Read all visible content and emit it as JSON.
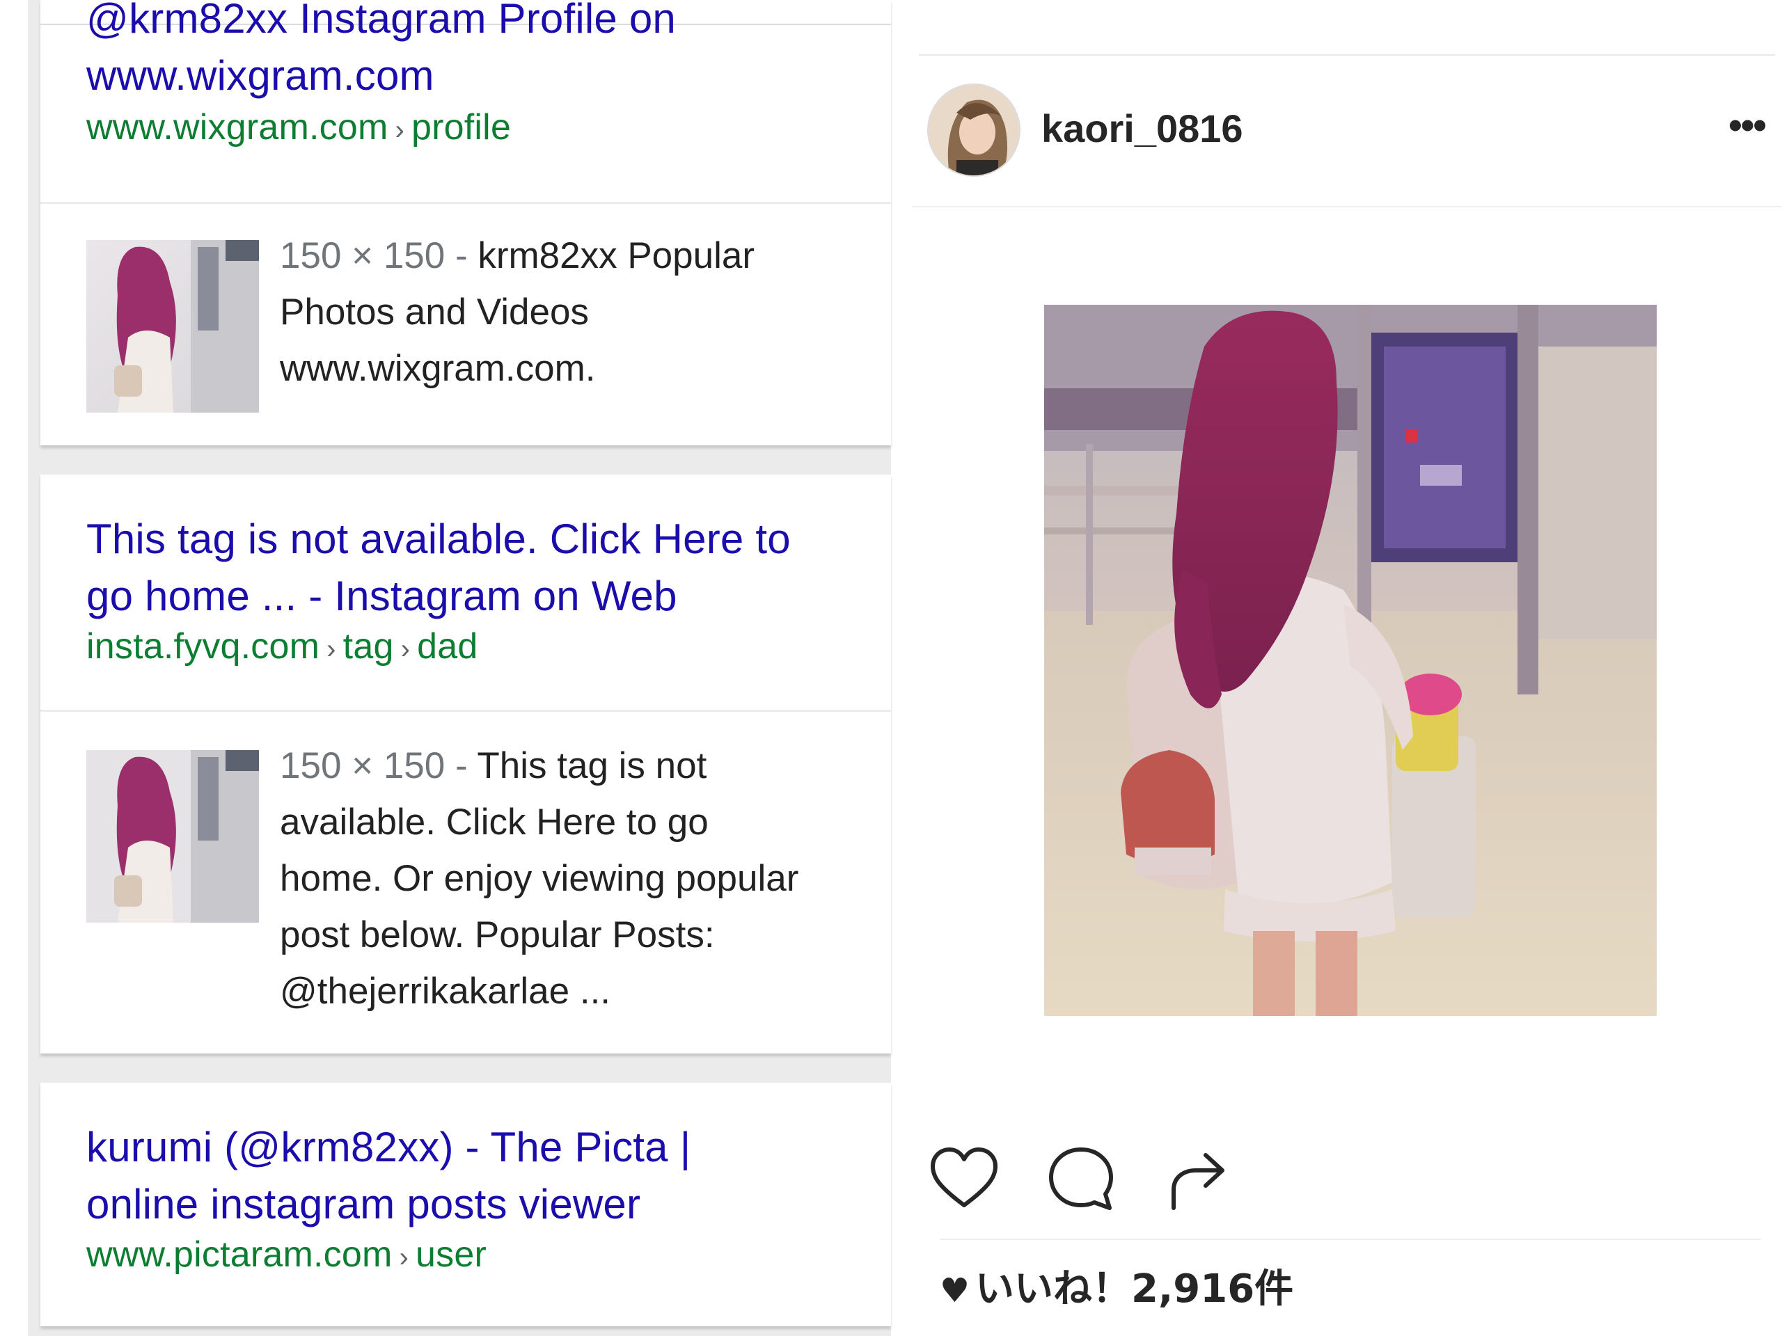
{
  "results": [
    {
      "title_lines": [
        "@krm82xx Instagram Profile on",
        "www.wixgram.com"
      ],
      "crumbs": [
        "www.wixgram.com",
        "profile"
      ],
      "snippet_dim": "150 × 150 - ",
      "snippet_text": "krm82xx Popular Photos and Videos www.wixgram.com.",
      "snippet_lines": [
        "krm82xx Popular",
        "Photos and Videos",
        "www.wixgram.com."
      ]
    },
    {
      "title_lines": [
        "This tag is not available. Click Here to",
        "go home ... - Instagram on Web"
      ],
      "crumbs": [
        "insta.fyvq.com",
        "tag",
        "dad"
      ],
      "snippet_dim": "150 × 150 - ",
      "snippet_lines": [
        "This tag is not",
        "available. Click Here to go",
        "home. Or enjoy viewing popular",
        "post below. Popular Posts:",
        "@thejerrikakarlae ..."
      ]
    },
    {
      "title_lines": [
        "kurumi (@krm82xx) - The Picta |",
        "online instagram posts viewer"
      ],
      "crumbs": [
        "www.pictaram.com",
        "user"
      ]
    }
  ],
  "instagram_post": {
    "username": "kaori_0816",
    "more_label": "•••",
    "like_icon": "heart-outline-icon",
    "comment_icon": "speech-bubble-icon",
    "share_icon": "share-arrow-icon",
    "likes_text": "いいね！2,916件"
  },
  "colors": {
    "link": "#1a0dab",
    "url_green": "#0d7d32",
    "text": "#222222",
    "muted": "#70757a"
  }
}
